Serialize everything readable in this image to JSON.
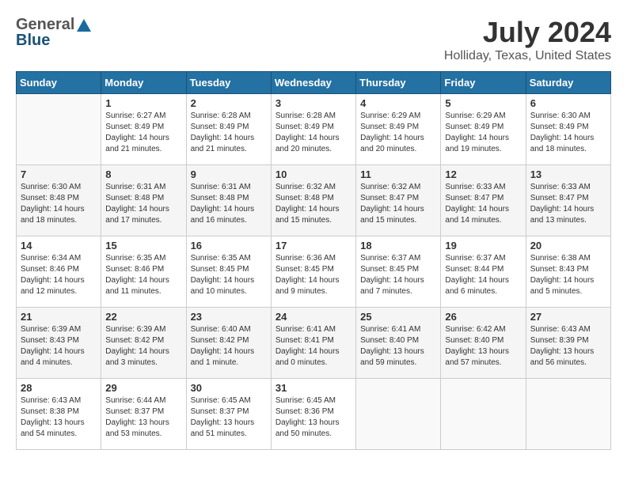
{
  "header": {
    "logo_general": "General",
    "logo_blue": "Blue",
    "title": "July 2024",
    "location": "Holliday, Texas, United States"
  },
  "days_of_week": [
    "Sunday",
    "Monday",
    "Tuesday",
    "Wednesday",
    "Thursday",
    "Friday",
    "Saturday"
  ],
  "weeks": [
    [
      {
        "day": "",
        "info": ""
      },
      {
        "day": "1",
        "info": "Sunrise: 6:27 AM\nSunset: 8:49 PM\nDaylight: 14 hours\nand 21 minutes."
      },
      {
        "day": "2",
        "info": "Sunrise: 6:28 AM\nSunset: 8:49 PM\nDaylight: 14 hours\nand 21 minutes."
      },
      {
        "day": "3",
        "info": "Sunrise: 6:28 AM\nSunset: 8:49 PM\nDaylight: 14 hours\nand 20 minutes."
      },
      {
        "day": "4",
        "info": "Sunrise: 6:29 AM\nSunset: 8:49 PM\nDaylight: 14 hours\nand 20 minutes."
      },
      {
        "day": "5",
        "info": "Sunrise: 6:29 AM\nSunset: 8:49 PM\nDaylight: 14 hours\nand 19 minutes."
      },
      {
        "day": "6",
        "info": "Sunrise: 6:30 AM\nSunset: 8:49 PM\nDaylight: 14 hours\nand 18 minutes."
      }
    ],
    [
      {
        "day": "7",
        "info": "Sunrise: 6:30 AM\nSunset: 8:48 PM\nDaylight: 14 hours\nand 18 minutes."
      },
      {
        "day": "8",
        "info": "Sunrise: 6:31 AM\nSunset: 8:48 PM\nDaylight: 14 hours\nand 17 minutes."
      },
      {
        "day": "9",
        "info": "Sunrise: 6:31 AM\nSunset: 8:48 PM\nDaylight: 14 hours\nand 16 minutes."
      },
      {
        "day": "10",
        "info": "Sunrise: 6:32 AM\nSunset: 8:48 PM\nDaylight: 14 hours\nand 15 minutes."
      },
      {
        "day": "11",
        "info": "Sunrise: 6:32 AM\nSunset: 8:47 PM\nDaylight: 14 hours\nand 15 minutes."
      },
      {
        "day": "12",
        "info": "Sunrise: 6:33 AM\nSunset: 8:47 PM\nDaylight: 14 hours\nand 14 minutes."
      },
      {
        "day": "13",
        "info": "Sunrise: 6:33 AM\nSunset: 8:47 PM\nDaylight: 14 hours\nand 13 minutes."
      }
    ],
    [
      {
        "day": "14",
        "info": "Sunrise: 6:34 AM\nSunset: 8:46 PM\nDaylight: 14 hours\nand 12 minutes."
      },
      {
        "day": "15",
        "info": "Sunrise: 6:35 AM\nSunset: 8:46 PM\nDaylight: 14 hours\nand 11 minutes."
      },
      {
        "day": "16",
        "info": "Sunrise: 6:35 AM\nSunset: 8:45 PM\nDaylight: 14 hours\nand 10 minutes."
      },
      {
        "day": "17",
        "info": "Sunrise: 6:36 AM\nSunset: 8:45 PM\nDaylight: 14 hours\nand 9 minutes."
      },
      {
        "day": "18",
        "info": "Sunrise: 6:37 AM\nSunset: 8:45 PM\nDaylight: 14 hours\nand 7 minutes."
      },
      {
        "day": "19",
        "info": "Sunrise: 6:37 AM\nSunset: 8:44 PM\nDaylight: 14 hours\nand 6 minutes."
      },
      {
        "day": "20",
        "info": "Sunrise: 6:38 AM\nSunset: 8:43 PM\nDaylight: 14 hours\nand 5 minutes."
      }
    ],
    [
      {
        "day": "21",
        "info": "Sunrise: 6:39 AM\nSunset: 8:43 PM\nDaylight: 14 hours\nand 4 minutes."
      },
      {
        "day": "22",
        "info": "Sunrise: 6:39 AM\nSunset: 8:42 PM\nDaylight: 14 hours\nand 3 minutes."
      },
      {
        "day": "23",
        "info": "Sunrise: 6:40 AM\nSunset: 8:42 PM\nDaylight: 14 hours\nand 1 minute."
      },
      {
        "day": "24",
        "info": "Sunrise: 6:41 AM\nSunset: 8:41 PM\nDaylight: 14 hours\nand 0 minutes."
      },
      {
        "day": "25",
        "info": "Sunrise: 6:41 AM\nSunset: 8:40 PM\nDaylight: 13 hours\nand 59 minutes."
      },
      {
        "day": "26",
        "info": "Sunrise: 6:42 AM\nSunset: 8:40 PM\nDaylight: 13 hours\nand 57 minutes."
      },
      {
        "day": "27",
        "info": "Sunrise: 6:43 AM\nSunset: 8:39 PM\nDaylight: 13 hours\nand 56 minutes."
      }
    ],
    [
      {
        "day": "28",
        "info": "Sunrise: 6:43 AM\nSunset: 8:38 PM\nDaylight: 13 hours\nand 54 minutes."
      },
      {
        "day": "29",
        "info": "Sunrise: 6:44 AM\nSunset: 8:37 PM\nDaylight: 13 hours\nand 53 minutes."
      },
      {
        "day": "30",
        "info": "Sunrise: 6:45 AM\nSunset: 8:37 PM\nDaylight: 13 hours\nand 51 minutes."
      },
      {
        "day": "31",
        "info": "Sunrise: 6:45 AM\nSunset: 8:36 PM\nDaylight: 13 hours\nand 50 minutes."
      },
      {
        "day": "",
        "info": ""
      },
      {
        "day": "",
        "info": ""
      },
      {
        "day": "",
        "info": ""
      }
    ]
  ]
}
